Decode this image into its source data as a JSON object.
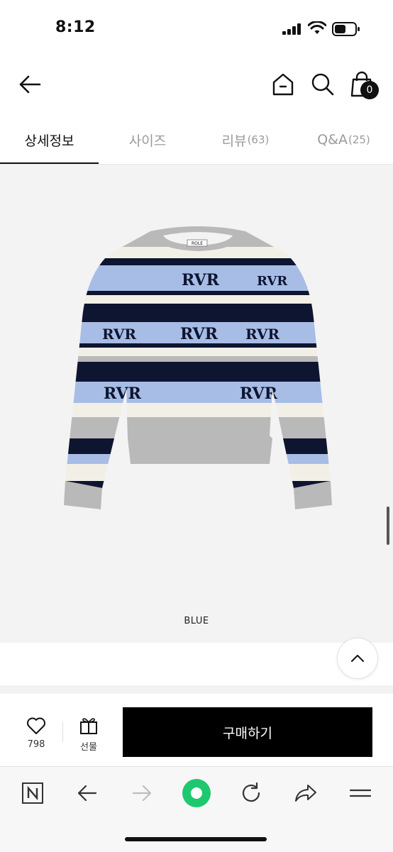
{
  "status_bar": {
    "time": "8:12"
  },
  "header": {
    "cart_count": "0"
  },
  "tabs": [
    {
      "label": "상세정보",
      "count": ""
    },
    {
      "label": "사이즈",
      "count": ""
    },
    {
      "label": "리뷰",
      "count": "(63)"
    },
    {
      "label": "Q&A",
      "count": "(25)"
    }
  ],
  "product": {
    "color_label": "BLUE",
    "label_text": "ROLE",
    "pattern_text": "RVR"
  },
  "buy_bar": {
    "like_count": "798",
    "gift_label": "선물",
    "buy_label": "구매하기"
  },
  "colors": {
    "accent": "#000000",
    "browser_green": "#1ec86e",
    "stripe_blue": "#a7bde6",
    "stripe_navy": "#0e1530",
    "heather": "#b9b9b9"
  }
}
